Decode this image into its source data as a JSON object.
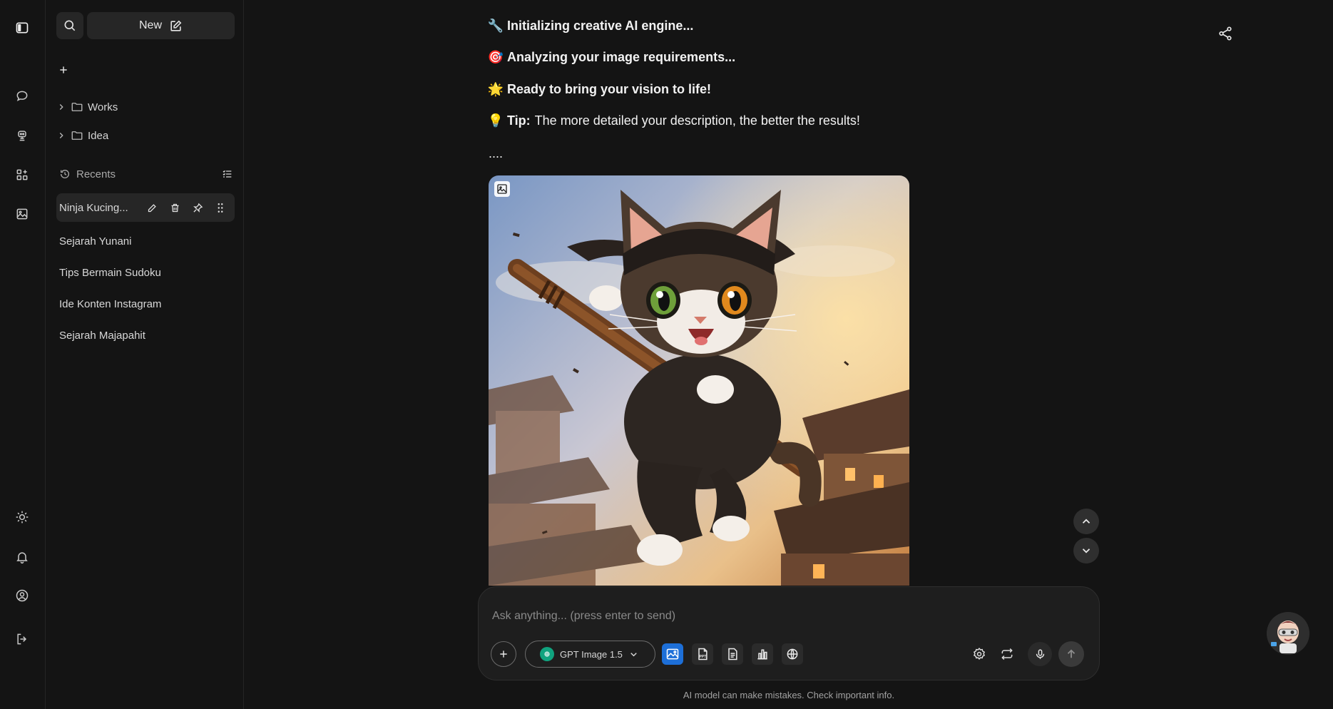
{
  "rail": {
    "icons": [
      "sidebar-toggle-icon",
      "chat-icon",
      "assistant-icon",
      "apps-icon",
      "image-icon",
      "sun-icon",
      "bell-icon",
      "user-circle-icon",
      "logout-icon"
    ]
  },
  "sidebar": {
    "new_label": "New",
    "folders": [
      {
        "label": "Works"
      },
      {
        "label": "Idea"
      }
    ],
    "recents_label": "Recents",
    "recents": [
      {
        "label": "Ninja Kucing..."
      },
      {
        "label": "Sejarah Yunani"
      },
      {
        "label": "Tips Bermain Sudoku"
      },
      {
        "label": "Ide Konten Instagram"
      },
      {
        "label": "Sejarah Majapahit"
      }
    ]
  },
  "chat": {
    "lines": [
      {
        "emoji": "🔧",
        "text": "Initializing creative AI engine..."
      },
      {
        "emoji": "🎯",
        "text": "Analyzing your image requirements..."
      },
      {
        "emoji": "🌟",
        "text": "Ready to bring your vision to life!"
      }
    ],
    "tip": {
      "emoji": "💡",
      "label": "Tip:",
      "text": "The more detailed your description, the better the results!"
    },
    "ellipsis": "...."
  },
  "composer": {
    "placeholder": "Ask anything... (press enter to send)",
    "model_label": "GPT Image 1.5",
    "tools": [
      "image-tool",
      "ppt-tool",
      "document-tool",
      "chart-tool",
      "web-search-tool"
    ],
    "footer": "AI model can make mistakes. Check important info."
  },
  "colors": {
    "background": "#141414",
    "surface": "#262626",
    "accent": "#1d6fd8",
    "model_logo": "#10a37f"
  }
}
